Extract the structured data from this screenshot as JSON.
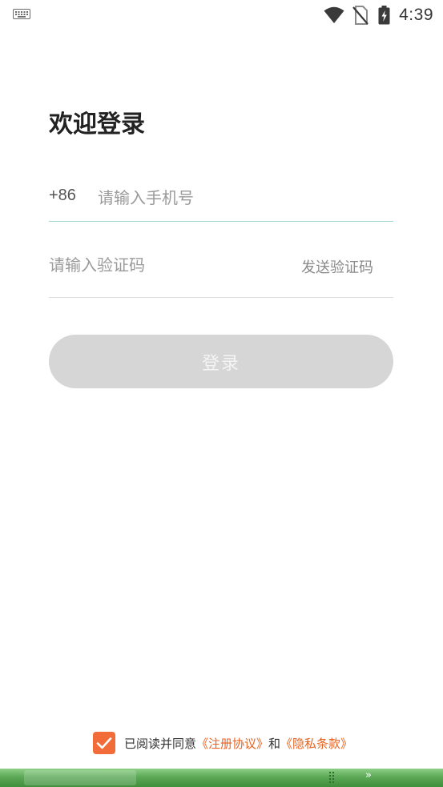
{
  "status_bar": {
    "time": "4:39",
    "icons": [
      "keyboard-icon",
      "wifi-icon",
      "no-sim-icon",
      "battery-charging-icon"
    ]
  },
  "title": "欢迎登录",
  "phone": {
    "country_code": "+86",
    "placeholder": "请输入手机号",
    "value": ""
  },
  "code": {
    "placeholder": "请输入验证码",
    "value": "",
    "send_label": "发送验证码"
  },
  "login_button": {
    "label": "登录",
    "enabled": false
  },
  "agreement": {
    "checked": true,
    "prefix": "已阅读并同意",
    "terms_link": "《注册协议》",
    "conjunction": "和",
    "privacy_link": "《隐私条款》"
  },
  "bottom_strip": {
    "more_label": "»"
  },
  "colors": {
    "accent": "#f26c3a",
    "link": "#e8611f",
    "button_disabled": "#d6d6d6",
    "active_underline": "#9fd6cf",
    "strip_green": "#5ca957"
  }
}
